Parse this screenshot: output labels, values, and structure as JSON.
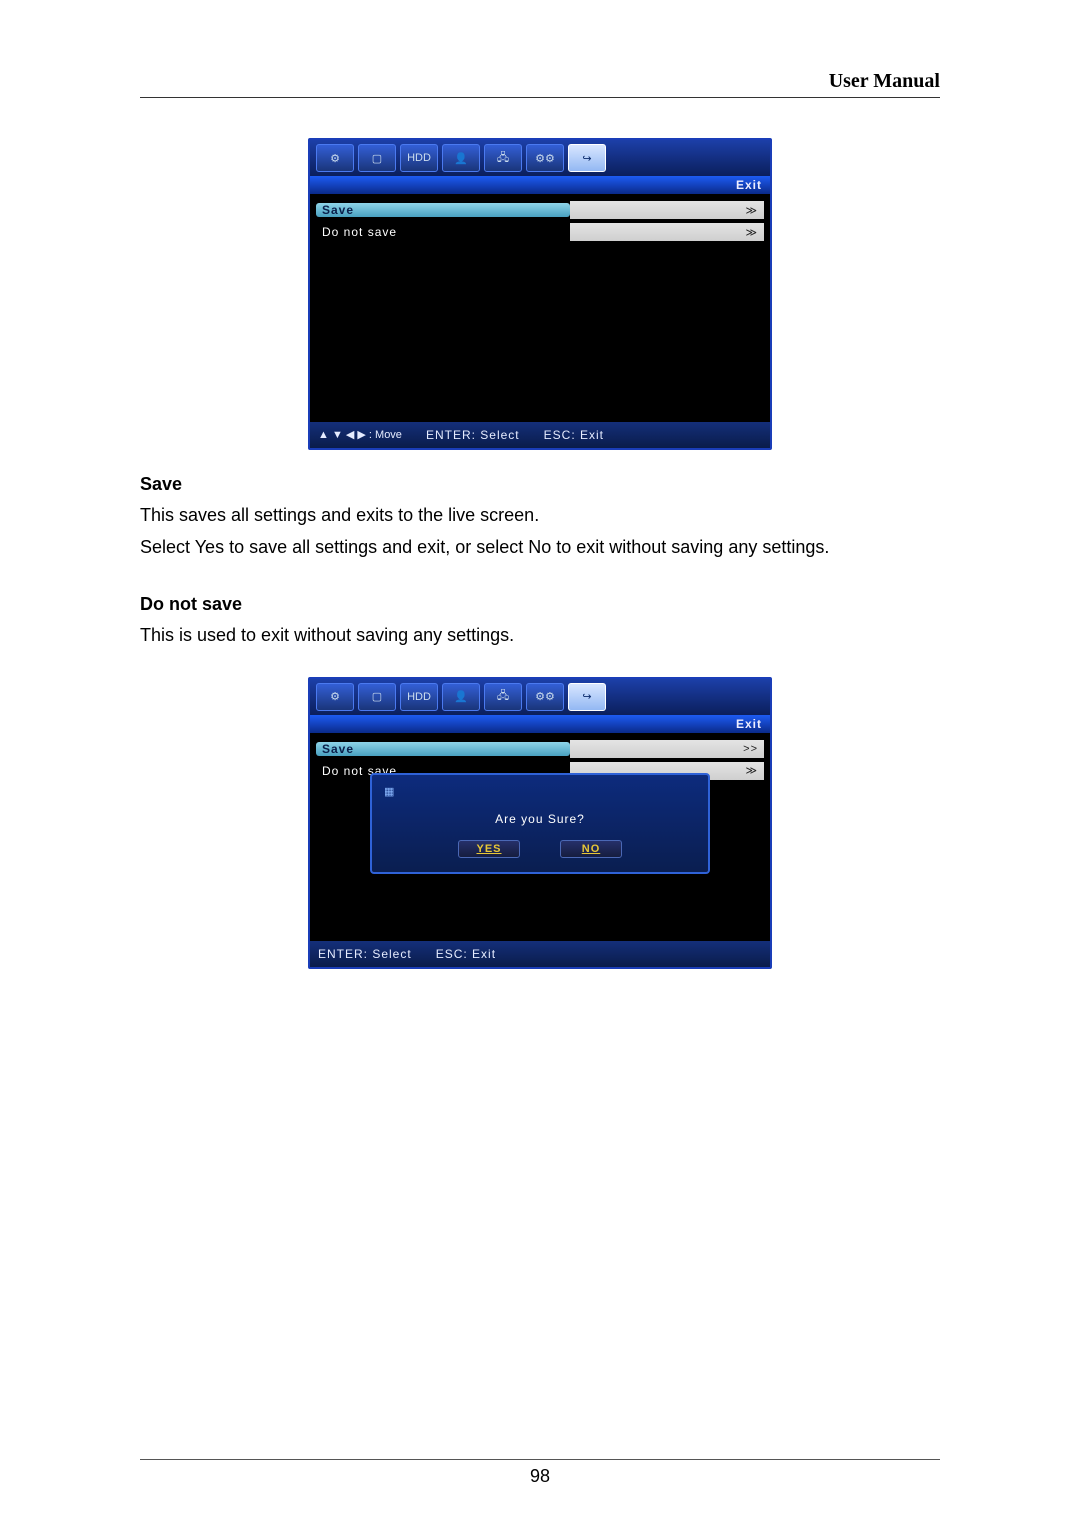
{
  "header": {
    "title": "User Manual"
  },
  "footer": {
    "page_number": "98"
  },
  "shot1": {
    "tabs": [
      "⚙",
      "▢",
      "HDD",
      "👤",
      "🖧",
      "⚙⚙",
      "↪"
    ],
    "active_tab_index": 6,
    "title": "Exit",
    "rows": [
      {
        "label": "Save",
        "value": "≫",
        "selected": true
      },
      {
        "label": "Do not save",
        "value": "≫",
        "selected": false
      }
    ],
    "hints": {
      "move": "▲ ▼ ◀ ▶ : Move",
      "enter": "ENTER: Select",
      "esc": "ESC: Exit"
    }
  },
  "section_save": {
    "heading": "Save",
    "p1": "This saves all settings and exits to the live screen.",
    "p2": "Select Yes to save all settings and exit, or select No to exit without saving any settings."
  },
  "section_donotsave": {
    "heading": "Do not save",
    "p1": "This is used to exit without saving any settings."
  },
  "shot2": {
    "tabs": [
      "⚙",
      "▢",
      "HDD",
      "👤",
      "🖧",
      "⚙⚙",
      "↪"
    ],
    "active_tab_index": 6,
    "title": "Exit",
    "rows": [
      {
        "label": "Save",
        "value": ">>",
        "selected": true
      },
      {
        "label": "Do not save",
        "value": "≫",
        "selected": false
      }
    ],
    "dialog": {
      "message": "Are you Sure?",
      "yes": "YES",
      "no": "NO"
    },
    "hints": {
      "enter": "ENTER: Select",
      "esc": "ESC: Exit"
    }
  }
}
